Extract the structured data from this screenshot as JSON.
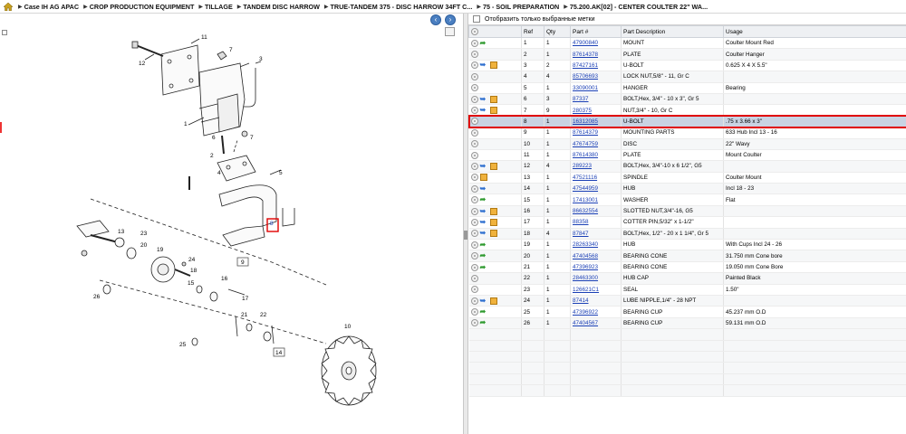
{
  "breadcrumb": {
    "items": [
      "Case IH AG APAC",
      "CROP PRODUCTION EQUIPMENT",
      "TILLAGE",
      "TANDEM DISC HARROW",
      "TRUE-TANDEM 375 - DISC HARROW 34FT C...",
      "75 - SOIL PREPARATION",
      "75.200.AK[02] - CENTER COULTER 22\" WA..."
    ]
  },
  "filter": {
    "label": "Отобразить только выбранные метки"
  },
  "table": {
    "headers": {
      "ref": "Ref",
      "qty": "Qty",
      "part": "Part #",
      "desc": "Part Description",
      "usage": "Usage"
    },
    "rows": [
      {
        "ref": "1",
        "qty": "1",
        "part": "47900840",
        "desc": "MOUNT",
        "usage": "Coulter Mount Red",
        "icons": [
          "green"
        ]
      },
      {
        "ref": "2",
        "qty": "1",
        "part": "87614378",
        "desc": "PLATE",
        "usage": "Coulter Hanger",
        "icons": []
      },
      {
        "ref": "3",
        "qty": "2",
        "part": "87427161",
        "desc": "U-BOLT",
        "usage": "0.625 X 4 X 5.5\"",
        "icons": [
          "blue",
          "box"
        ]
      },
      {
        "ref": "4",
        "qty": "4",
        "part": "85706693",
        "desc": "LOCK NUT,5/8\" - 11, Gr C",
        "icons": [],
        "usage": ""
      },
      {
        "ref": "5",
        "qty": "1",
        "part": "33090001",
        "desc": "HANGER",
        "usage": "Bearing",
        "icons": []
      },
      {
        "ref": "6",
        "qty": "3",
        "part": "87337",
        "desc": "BOLT,Hex, 3/4\" - 10 x 3\", Gr 5",
        "usage": "",
        "icons": [
          "blue",
          "box"
        ]
      },
      {
        "ref": "7",
        "qty": "9",
        "part": "280375",
        "desc": "NUT,3/4\" - 10, Gr C",
        "usage": "",
        "icons": [
          "blue",
          "box"
        ]
      },
      {
        "ref": "8",
        "qty": "1",
        "part": "16312085",
        "desc": "U-BOLT",
        "usage": ".75 x 3.66 x 3\"",
        "icons": []
      },
      {
        "ref": "9",
        "qty": "1",
        "part": "87614379",
        "desc": "MOUNTING PARTS",
        "usage": "633 Hub Incl 13 - 16",
        "icons": []
      },
      {
        "ref": "10",
        "qty": "1",
        "part": "47674759",
        "desc": "DISC",
        "usage": "22\" Wavy",
        "icons": []
      },
      {
        "ref": "11",
        "qty": "1",
        "part": "87614380",
        "desc": "PLATE",
        "usage": "Mount Coulter",
        "icons": []
      },
      {
        "ref": "12",
        "qty": "4",
        "part": "289223",
        "desc": "BOLT,Hex, 3/4\"-10 x 6 1/2\", G5",
        "usage": "",
        "icons": [
          "blue",
          "box"
        ]
      },
      {
        "ref": "13",
        "qty": "1",
        "part": "47521116",
        "desc": "SPINDLE",
        "usage": "Coulter Mount",
        "icons": [
          "box"
        ]
      },
      {
        "ref": "14",
        "qty": "1",
        "part": "47544959",
        "desc": "HUB",
        "usage": "Incl 18 - 23",
        "icons": [
          "blue"
        ]
      },
      {
        "ref": "15",
        "qty": "1",
        "part": "17413001",
        "desc": "WASHER",
        "usage": "Flat",
        "icons": [
          "green"
        ]
      },
      {
        "ref": "16",
        "qty": "1",
        "part": "86632554",
        "desc": "SLOTTED NUT,3/4\"-16, G5",
        "usage": "",
        "icons": [
          "blue",
          "box"
        ]
      },
      {
        "ref": "17",
        "qty": "1",
        "part": "88358",
        "desc": "COTTER PIN,5/32\" x 1-1/2\"",
        "usage": "",
        "icons": [
          "blue",
          "box"
        ]
      },
      {
        "ref": "18",
        "qty": "4",
        "part": "87847",
        "desc": "BOLT,Hex, 1/2\" - 20 x 1 1/4\", Gr 5",
        "usage": "",
        "icons": [
          "blue",
          "box"
        ]
      },
      {
        "ref": "19",
        "qty": "1",
        "part": "28263340",
        "desc": "HUB",
        "usage": "With Cups  Incl 24 - 26",
        "icons": [
          "green"
        ]
      },
      {
        "ref": "20",
        "qty": "1",
        "part": "47404568",
        "desc": "BEARING CONE",
        "usage": "31.750 mm Cone bore",
        "icons": [
          "green"
        ]
      },
      {
        "ref": "21",
        "qty": "1",
        "part": "47396923",
        "desc": "BEARING CONE",
        "usage": "19.050 mm Cone Bore",
        "icons": [
          "green"
        ]
      },
      {
        "ref": "22",
        "qty": "1",
        "part": "28463300",
        "desc": "HUB CAP",
        "usage": "Painted Black",
        "icons": []
      },
      {
        "ref": "23",
        "qty": "1",
        "part": "126621C1",
        "desc": "SEAL",
        "usage": "1.50\"",
        "icons": []
      },
      {
        "ref": "24",
        "qty": "1",
        "part": "87414",
        "desc": "LUBE NIPPLE,1/4\" - 28 NPT",
        "usage": "",
        "icons": [
          "blue",
          "box"
        ]
      },
      {
        "ref": "25",
        "qty": "1",
        "part": "47396922",
        "desc": "BEARING CUP",
        "usage": "45.237 mm O.D",
        "icons": [
          "green"
        ]
      },
      {
        "ref": "26",
        "qty": "1",
        "part": "47404567",
        "desc": "BEARING CUP",
        "usage": "59.131 mm O.D",
        "icons": [
          "green"
        ]
      }
    ],
    "selected_ref": "8"
  },
  "diagram": {
    "callouts": [
      "1",
      "2",
      "3",
      "4",
      "5",
      "6",
      "7",
      "8",
      "9",
      "10",
      "11",
      "12",
      "13",
      "14",
      "15",
      "16",
      "17",
      "18",
      "19",
      "20",
      "21",
      "22",
      "23",
      "24",
      "25",
      "26"
    ]
  }
}
